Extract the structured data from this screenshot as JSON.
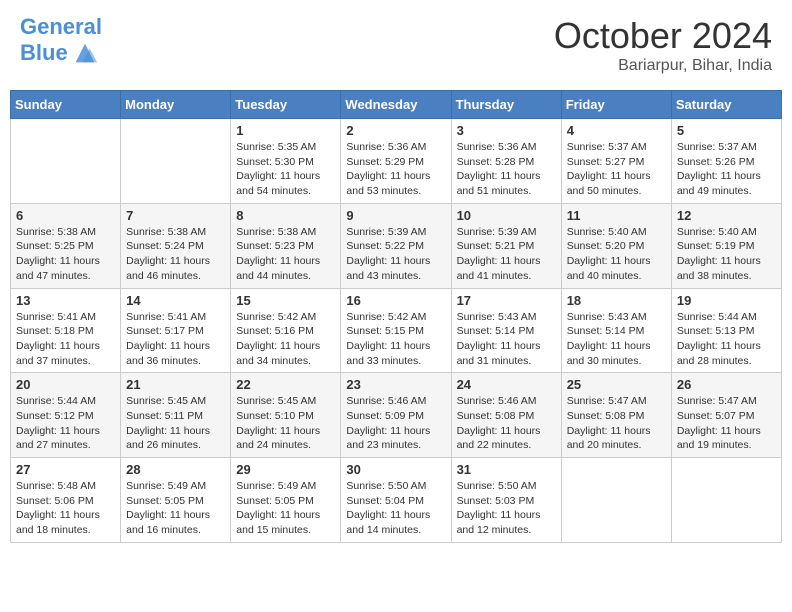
{
  "header": {
    "logo_line1": "General",
    "logo_line2": "Blue",
    "month": "October 2024",
    "location": "Bariarpur, Bihar, India"
  },
  "weekdays": [
    "Sunday",
    "Monday",
    "Tuesday",
    "Wednesday",
    "Thursday",
    "Friday",
    "Saturday"
  ],
  "weeks": [
    [
      {
        "day": "",
        "sunrise": "",
        "sunset": "",
        "daylight": ""
      },
      {
        "day": "",
        "sunrise": "",
        "sunset": "",
        "daylight": ""
      },
      {
        "day": "1",
        "sunrise": "Sunrise: 5:35 AM",
        "sunset": "Sunset: 5:30 PM",
        "daylight": "Daylight: 11 hours and 54 minutes."
      },
      {
        "day": "2",
        "sunrise": "Sunrise: 5:36 AM",
        "sunset": "Sunset: 5:29 PM",
        "daylight": "Daylight: 11 hours and 53 minutes."
      },
      {
        "day": "3",
        "sunrise": "Sunrise: 5:36 AM",
        "sunset": "Sunset: 5:28 PM",
        "daylight": "Daylight: 11 hours and 51 minutes."
      },
      {
        "day": "4",
        "sunrise": "Sunrise: 5:37 AM",
        "sunset": "Sunset: 5:27 PM",
        "daylight": "Daylight: 11 hours and 50 minutes."
      },
      {
        "day": "5",
        "sunrise": "Sunrise: 5:37 AM",
        "sunset": "Sunset: 5:26 PM",
        "daylight": "Daylight: 11 hours and 49 minutes."
      }
    ],
    [
      {
        "day": "6",
        "sunrise": "Sunrise: 5:38 AM",
        "sunset": "Sunset: 5:25 PM",
        "daylight": "Daylight: 11 hours and 47 minutes."
      },
      {
        "day": "7",
        "sunrise": "Sunrise: 5:38 AM",
        "sunset": "Sunset: 5:24 PM",
        "daylight": "Daylight: 11 hours and 46 minutes."
      },
      {
        "day": "8",
        "sunrise": "Sunrise: 5:38 AM",
        "sunset": "Sunset: 5:23 PM",
        "daylight": "Daylight: 11 hours and 44 minutes."
      },
      {
        "day": "9",
        "sunrise": "Sunrise: 5:39 AM",
        "sunset": "Sunset: 5:22 PM",
        "daylight": "Daylight: 11 hours and 43 minutes."
      },
      {
        "day": "10",
        "sunrise": "Sunrise: 5:39 AM",
        "sunset": "Sunset: 5:21 PM",
        "daylight": "Daylight: 11 hours and 41 minutes."
      },
      {
        "day": "11",
        "sunrise": "Sunrise: 5:40 AM",
        "sunset": "Sunset: 5:20 PM",
        "daylight": "Daylight: 11 hours and 40 minutes."
      },
      {
        "day": "12",
        "sunrise": "Sunrise: 5:40 AM",
        "sunset": "Sunset: 5:19 PM",
        "daylight": "Daylight: 11 hours and 38 minutes."
      }
    ],
    [
      {
        "day": "13",
        "sunrise": "Sunrise: 5:41 AM",
        "sunset": "Sunset: 5:18 PM",
        "daylight": "Daylight: 11 hours and 37 minutes."
      },
      {
        "day": "14",
        "sunrise": "Sunrise: 5:41 AM",
        "sunset": "Sunset: 5:17 PM",
        "daylight": "Daylight: 11 hours and 36 minutes."
      },
      {
        "day": "15",
        "sunrise": "Sunrise: 5:42 AM",
        "sunset": "Sunset: 5:16 PM",
        "daylight": "Daylight: 11 hours and 34 minutes."
      },
      {
        "day": "16",
        "sunrise": "Sunrise: 5:42 AM",
        "sunset": "Sunset: 5:15 PM",
        "daylight": "Daylight: 11 hours and 33 minutes."
      },
      {
        "day": "17",
        "sunrise": "Sunrise: 5:43 AM",
        "sunset": "Sunset: 5:14 PM",
        "daylight": "Daylight: 11 hours and 31 minutes."
      },
      {
        "day": "18",
        "sunrise": "Sunrise: 5:43 AM",
        "sunset": "Sunset: 5:14 PM",
        "daylight": "Daylight: 11 hours and 30 minutes."
      },
      {
        "day": "19",
        "sunrise": "Sunrise: 5:44 AM",
        "sunset": "Sunset: 5:13 PM",
        "daylight": "Daylight: 11 hours and 28 minutes."
      }
    ],
    [
      {
        "day": "20",
        "sunrise": "Sunrise: 5:44 AM",
        "sunset": "Sunset: 5:12 PM",
        "daylight": "Daylight: 11 hours and 27 minutes."
      },
      {
        "day": "21",
        "sunrise": "Sunrise: 5:45 AM",
        "sunset": "Sunset: 5:11 PM",
        "daylight": "Daylight: 11 hours and 26 minutes."
      },
      {
        "day": "22",
        "sunrise": "Sunrise: 5:45 AM",
        "sunset": "Sunset: 5:10 PM",
        "daylight": "Daylight: 11 hours and 24 minutes."
      },
      {
        "day": "23",
        "sunrise": "Sunrise: 5:46 AM",
        "sunset": "Sunset: 5:09 PM",
        "daylight": "Daylight: 11 hours and 23 minutes."
      },
      {
        "day": "24",
        "sunrise": "Sunrise: 5:46 AM",
        "sunset": "Sunset: 5:08 PM",
        "daylight": "Daylight: 11 hours and 22 minutes."
      },
      {
        "day": "25",
        "sunrise": "Sunrise: 5:47 AM",
        "sunset": "Sunset: 5:08 PM",
        "daylight": "Daylight: 11 hours and 20 minutes."
      },
      {
        "day": "26",
        "sunrise": "Sunrise: 5:47 AM",
        "sunset": "Sunset: 5:07 PM",
        "daylight": "Daylight: 11 hours and 19 minutes."
      }
    ],
    [
      {
        "day": "27",
        "sunrise": "Sunrise: 5:48 AM",
        "sunset": "Sunset: 5:06 PM",
        "daylight": "Daylight: 11 hours and 18 minutes."
      },
      {
        "day": "28",
        "sunrise": "Sunrise: 5:49 AM",
        "sunset": "Sunset: 5:05 PM",
        "daylight": "Daylight: 11 hours and 16 minutes."
      },
      {
        "day": "29",
        "sunrise": "Sunrise: 5:49 AM",
        "sunset": "Sunset: 5:05 PM",
        "daylight": "Daylight: 11 hours and 15 minutes."
      },
      {
        "day": "30",
        "sunrise": "Sunrise: 5:50 AM",
        "sunset": "Sunset: 5:04 PM",
        "daylight": "Daylight: 11 hours and 14 minutes."
      },
      {
        "day": "31",
        "sunrise": "Sunrise: 5:50 AM",
        "sunset": "Sunset: 5:03 PM",
        "daylight": "Daylight: 11 hours and 12 minutes."
      },
      {
        "day": "",
        "sunrise": "",
        "sunset": "",
        "daylight": ""
      },
      {
        "day": "",
        "sunrise": "",
        "sunset": "",
        "daylight": ""
      }
    ]
  ]
}
